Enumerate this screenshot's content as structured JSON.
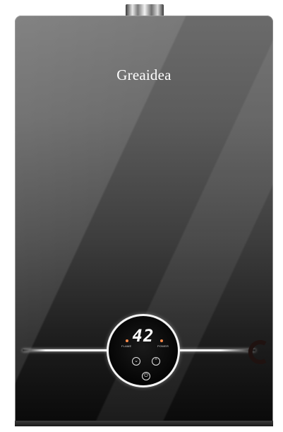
{
  "product": {
    "brand": "Greaidea",
    "display": {
      "temperature": "42",
      "flame_label": "FLAME",
      "power_label": "POWER"
    },
    "icons": [
      "down-arrow-icon",
      "up-arrow-icon",
      "power-icon"
    ],
    "colors": {
      "body_top": "#6b6b6b",
      "body_bottom": "#0a0a0a",
      "indicator": "#ff8a4a",
      "accent_c": "#1f1210"
    }
  }
}
